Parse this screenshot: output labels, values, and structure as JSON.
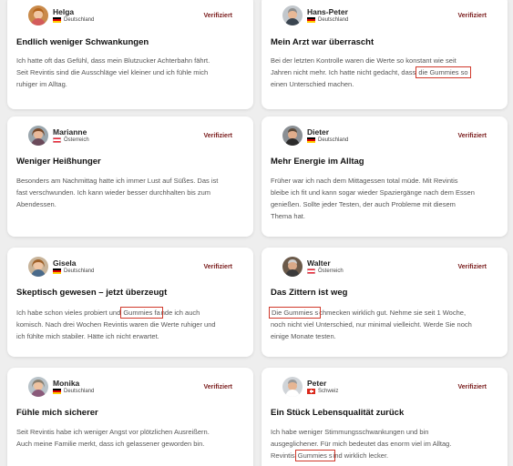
{
  "verified_label": "Verifiziert",
  "colors": {
    "accent": "#7a1c1c",
    "highlight_box": "#d0392b"
  },
  "reviews": [
    {
      "name": "Helga",
      "country": "Deutschland",
      "flag": "de",
      "title": "Endlich weniger Schwankungen",
      "text": [
        "Ich hatte oft das Gefühl, dass mein Blutzucker Achterbahn fährt.",
        "Seit Revintis sind die Ausschläge viel kleiner und ich fühle mich",
        "ruhiger im Alltag."
      ]
    },
    {
      "name": "Hans-Peter",
      "country": "Deutschland",
      "flag": "de",
      "title": "Mein Arzt war überrascht",
      "text_a": "Bei der letzten Kontrolle waren die Werte so konstant wie seit",
      "text_b_pre": "Jahren nicht mehr. Ich hatte nicht gedacht, dass ",
      "text_b_hl": "die Gummies so",
      "text_c": "einen Unterschied machen."
    },
    {
      "name": "Marianne",
      "country": "Österreich",
      "flag": "at",
      "title": "Weniger Heißhunger",
      "text": [
        "Besonders am Nachmittag hatte ich immer Lust auf Süßes. Das ist",
        "fast verschwunden. Ich kann wieder besser durchhalten bis zum",
        "Abendessen."
      ]
    },
    {
      "name": "Dieter",
      "country": "Deutschland",
      "flag": "de",
      "title": "Mehr Energie im Alltag",
      "text": [
        "Früher war ich nach dem Mittagessen total müde. Mit Revintis",
        "bleibe ich fit und kann sogar wieder Spaziergänge nach dem Essen",
        "genießen. Sollte jeder Testen, der auch Probleme mit diesem",
        "Thema hat."
      ]
    },
    {
      "name": "Gisela",
      "country": "Deutschland",
      "flag": "de",
      "title": "Skeptisch gewesen – jetzt überzeugt",
      "text_a_pre": "Ich habe schon vieles probiert und ",
      "text_a_hl": "Gummies fa",
      "text_a_post": "nde ich auch",
      "text_b": "komisch. Nach drei Wochen Revintis waren die Werte ruhiger und",
      "text_c": "ich fühlte mich stabiler. Hätte ich nicht erwartet."
    },
    {
      "name": "Walter",
      "country": "Österreich",
      "flag": "at",
      "title": "Das Zittern ist weg",
      "text_a_hl": "Die Gummies s",
      "text_a_post": "chmecken wirklich gut. Nehme sie seit 1 Woche,",
      "text_b": "noch nicht viel Unterschied, nur minimal vielleicht. Werde Sie noch",
      "text_c": "einige Monate testen."
    },
    {
      "name": "Monika",
      "country": "Deutschland",
      "flag": "de",
      "title": "Fühle mich sicherer",
      "text": [
        "Seit Revintis habe ich weniger Angst vor plötzlichen Ausreißern.",
        "Auch meine Familie merkt, dass ich gelassener geworden bin."
      ]
    },
    {
      "name": "Peter",
      "country": "Schweiz",
      "flag": "ch",
      "title": "Ein Stück Lebensqualität zurück",
      "text_a": "Ich habe weniger Stimmungsschwankungen und bin",
      "text_b": "ausgeglichener. Für mich bedeutet das enorm viel im Alltag.",
      "text_c_pre": "Revintis ",
      "text_c_hl": "Gummies s",
      "text_c_post": "ind wirklich lecker."
    }
  ]
}
